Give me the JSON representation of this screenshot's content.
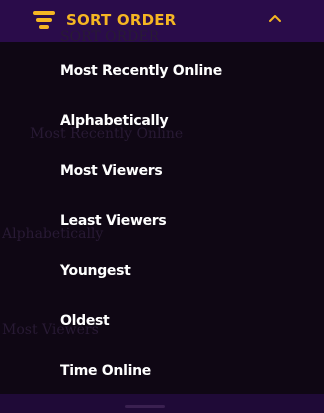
{
  "header": {
    "title": "SORT ORDER",
    "icon": "sort-lines-icon",
    "toggle_icon": "chevron-up-icon",
    "accent_color": "#f5b623",
    "background_color": "#2a0c4a"
  },
  "menu": {
    "items": [
      {
        "label": "Most Recently Online"
      },
      {
        "label": "Alphabetically"
      },
      {
        "label": "Most Viewers"
      },
      {
        "label": "Least Viewers"
      },
      {
        "label": "Youngest"
      },
      {
        "label": "Oldest"
      },
      {
        "label": "Time Online"
      }
    ]
  }
}
